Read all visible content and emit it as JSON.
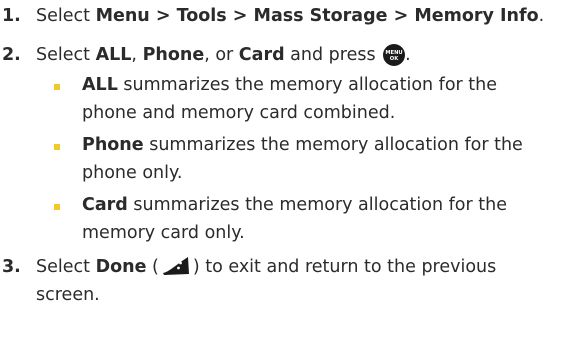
{
  "steps": [
    {
      "num": "1.",
      "parts": [
        "Select ",
        "Menu > Tools > Mass Storage > Memory Info",
        "."
      ]
    },
    {
      "num": "2.",
      "parts": [
        "Select ",
        "ALL",
        ", ",
        "Phone",
        ", or ",
        "Card",
        " and press ",
        "."
      ],
      "icon": "menu-ok-key-icon",
      "icon_text_top": "MENU",
      "icon_text_bottom": "OK",
      "sub_items": [
        {
          "term": "ALL",
          "text": " summarizes the memory allocation for the phone and memory card combined."
        },
        {
          "term": "Phone",
          "text": " summarizes the memory allocation for the phone only."
        },
        {
          "term": "Card",
          "text": " summarizes the memory allocation for the memory card only."
        }
      ]
    },
    {
      "num": "3.",
      "parts": [
        "Select ",
        "Done",
        " (",
        ") to exit and return to the previous screen."
      ],
      "icon": "back-softkey-icon"
    }
  ],
  "colors": {
    "text": "#2b2b2b",
    "bullet": "#f3c927",
    "icon": "#1a1a1a"
  }
}
